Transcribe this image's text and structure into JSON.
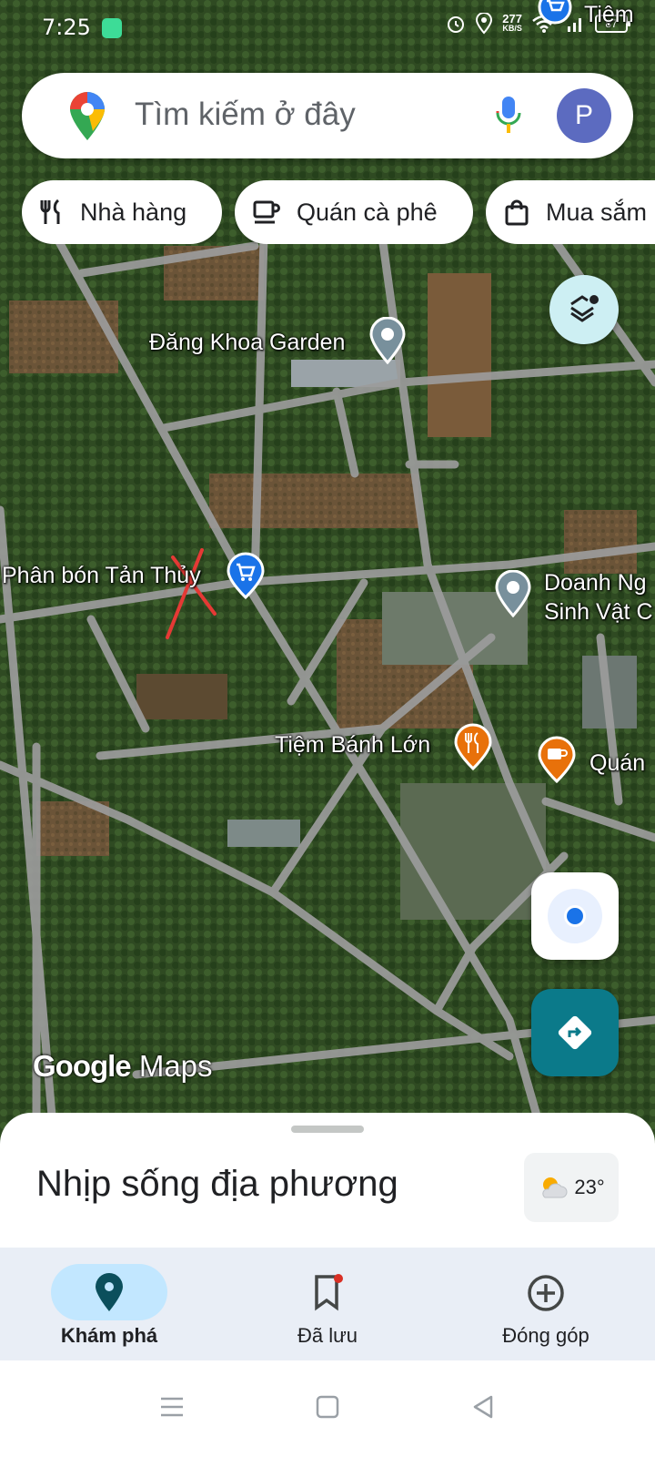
{
  "status_bar": {
    "time": "7:25",
    "network_speed_value": "277",
    "network_speed_unit": "KB/S",
    "battery": "87"
  },
  "search": {
    "placeholder": "Tìm kiếm ở đây",
    "avatar_letter": "P"
  },
  "chips": [
    {
      "label": "Nhà hàng",
      "icon": "restaurant-icon"
    },
    {
      "label": "Quán cà phê",
      "icon": "coffee-icon"
    },
    {
      "label": "Mua sắm",
      "icon": "shopping-bag-icon"
    }
  ],
  "map_labels": {
    "top_right": "Tiệm",
    "dang_khoa": "Đăng Khoa Garden",
    "phan_bon": "Phân bón Tản Thủy",
    "doanh_line1": "Doanh Ng",
    "doanh_line2": "Sinh Vật C",
    "tiem_banh": "Tiệm Bánh Lớn",
    "quan": "Quán"
  },
  "logo": {
    "google": "Google",
    "maps": "Maps"
  },
  "sheet": {
    "title": "Nhịp sống địa phương",
    "temperature": "23°"
  },
  "bottom_nav": {
    "explore": "Khám phá",
    "saved": "Đã lưu",
    "contribute": "Đóng góp"
  },
  "colors": {
    "accent_teal": "#0b7a8a",
    "nav_active_pill": "#c2e7ff",
    "avatar": "#5c6bc0",
    "poi_blue": "#1a73e8",
    "poi_orange": "#e8710a",
    "poi_gray": "#78909c"
  }
}
